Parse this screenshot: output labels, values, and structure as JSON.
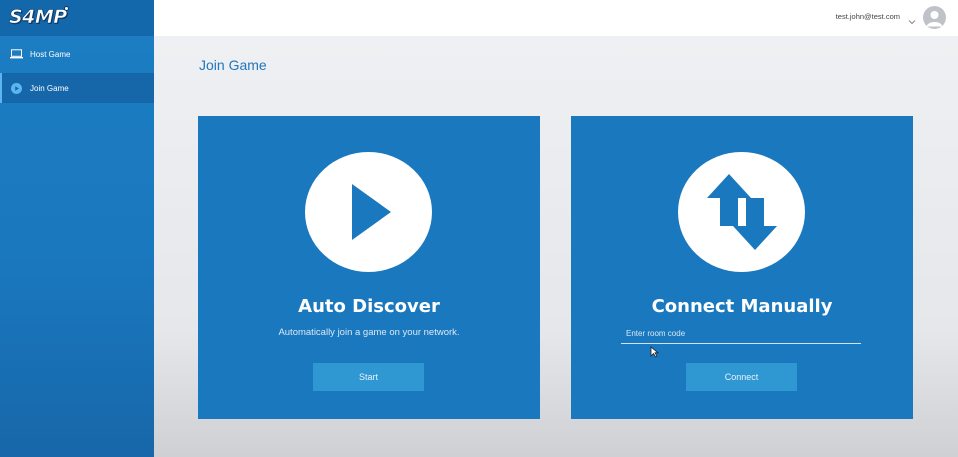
{
  "app": {
    "logo_text": "S4MP"
  },
  "sidebar": {
    "items": [
      {
        "label": "Host Game",
        "icon": "laptop-icon",
        "active": false
      },
      {
        "label": "Join Game",
        "icon": "play-circle-icon",
        "active": true
      }
    ]
  },
  "header": {
    "user_email": "test.john@test.com",
    "dropdown_icon": "chevron-down-icon",
    "avatar_icon": "user-avatar-icon"
  },
  "main": {
    "title": "Join Game",
    "cards": {
      "auto": {
        "icon": "play-icon",
        "title": "Auto Discover",
        "description": "Automatically join a game on your network.",
        "button_label": "Start"
      },
      "manual": {
        "icon": "swap-vertical-arrows-icon",
        "title": "Connect Manually",
        "input_placeholder": "Enter room code",
        "input_value": "",
        "button_label": "Connect"
      }
    }
  },
  "colors": {
    "accent": "#1a78bf",
    "sidebar": "#1c7ec4",
    "button": "#2f98d2",
    "title": "#2276bd"
  }
}
